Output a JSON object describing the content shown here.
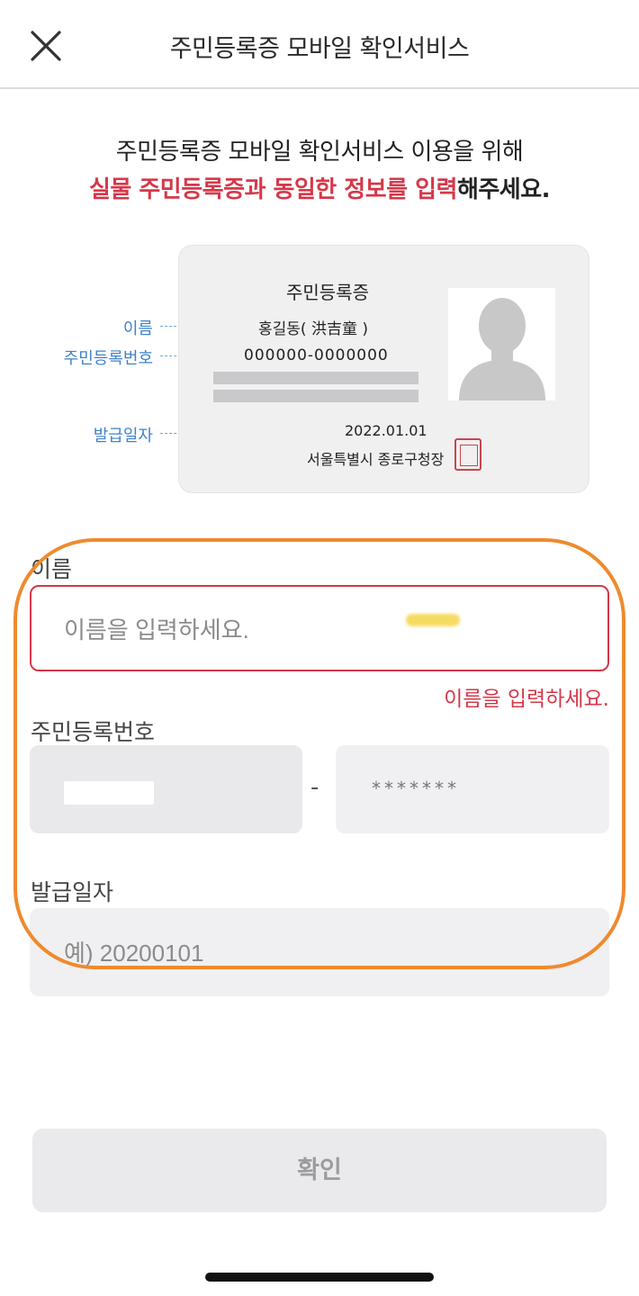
{
  "header": {
    "title": "주민등록증 모바일 확인서비스",
    "close_icon": "close-icon"
  },
  "intro": {
    "line1": "주민등록증 모바일 확인서비스 이용을 위해",
    "line2_highlight": "실물 주민등록증과 동일한 정보를 입력",
    "line2_suffix": "해주세요."
  },
  "id_card": {
    "title": "주민등록증",
    "name": "홍길동( 洪吉童 )",
    "rrn": "000000-0000000",
    "issue_date": "2022.01.01",
    "issuer": "서울특별시 종로구청장",
    "annotations": {
      "name": "이름",
      "rrn": "주민등록번호",
      "issue_date": "발급일자"
    }
  },
  "form": {
    "name_label": "이름",
    "name_placeholder": "이름을 입력하세요.",
    "name_value": "",
    "name_error": "이름을 입력하세요.",
    "rrn_label": "주민등록번호",
    "rrn_separator": "-",
    "rrn_back_display": "*******",
    "issue_date_label": "발급일자",
    "issue_date_placeholder": "예) 20200101",
    "issue_date_value": ""
  },
  "buttons": {
    "confirm_label": "확인"
  },
  "colors": {
    "accent_red": "#d5384a",
    "annotation_blue": "#3f83c9",
    "highlight_orange": "#ef8a2d"
  }
}
